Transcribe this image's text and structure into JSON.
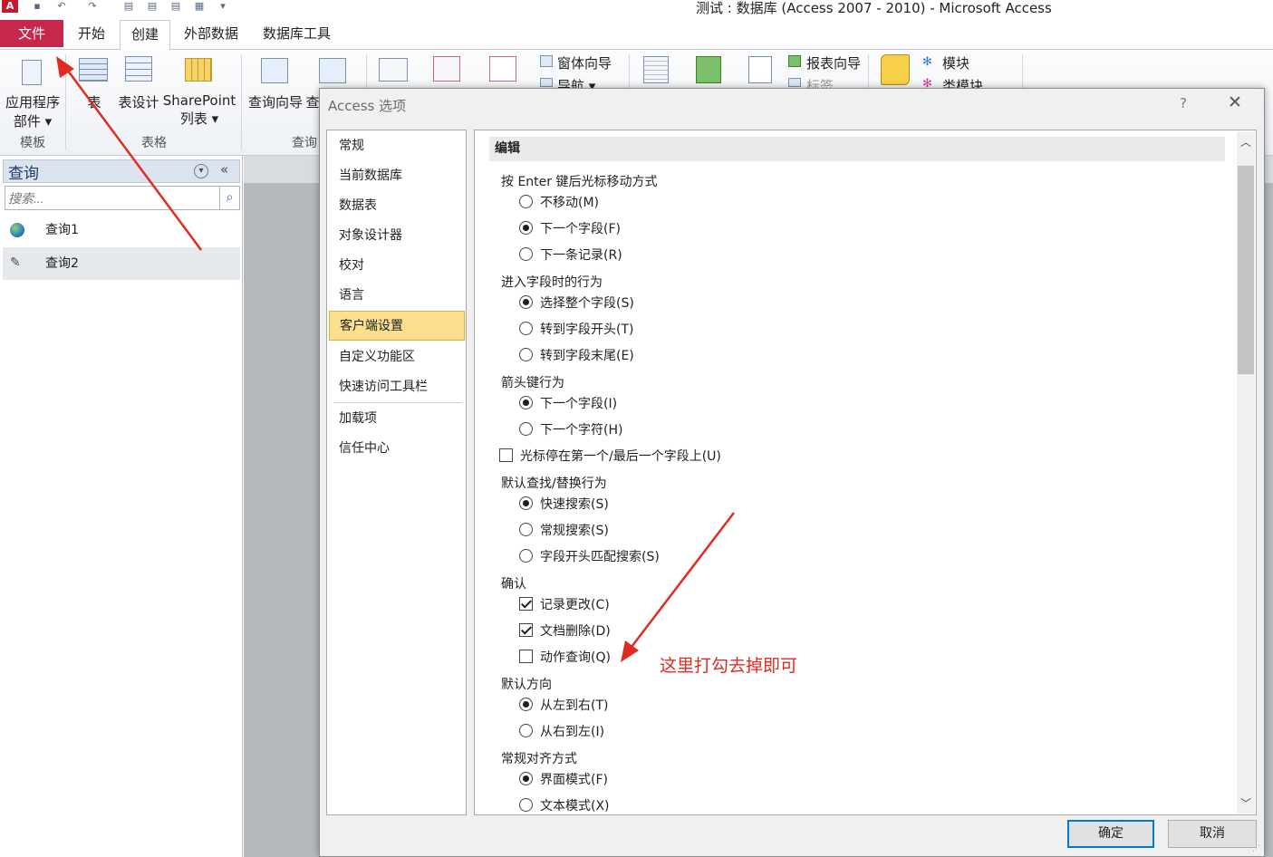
{
  "window": {
    "title": "测试 : 数据库 (Access 2007 - 2010)  -  Microsoft Access",
    "logo": "A"
  },
  "ribbon": {
    "tabs": [
      "文件",
      "开始",
      "创建",
      "外部数据",
      "数据库工具"
    ],
    "active_tab": "创建",
    "buttons": {
      "app_parts_line1": "应用程序",
      "app_parts_line2": "部件 ▾",
      "table": "表",
      "table_design": "表设计",
      "sharepoint_line1": "SharePoint",
      "sharepoint_line2": "列表 ▾",
      "query_wizard": "查询向导",
      "query_design_partial": "查",
      "form_wizard": "窗体向导",
      "navigation": "导航 ▾",
      "report_wizard": "报表向导",
      "labels": "标签",
      "module": "模块",
      "class_module": "类模块"
    },
    "groups": {
      "templates": "模板",
      "tables": "表格",
      "queries": "查询"
    }
  },
  "nav_pane": {
    "title": "查询",
    "search_placeholder": "搜索...",
    "items": [
      {
        "label": "查询1",
        "icon": "globe-query-icon"
      },
      {
        "label": "查询2",
        "icon": "update-query-icon",
        "selected": true
      }
    ]
  },
  "dialog": {
    "title": "Access 选项",
    "help": "?",
    "close": "✕",
    "nav": [
      "常规",
      "当前数据库",
      "数据表",
      "对象设计器",
      "校对",
      "语言",
      "客户端设置",
      "自定义功能区",
      "快速访问工具栏",
      "加载项",
      "信任中心"
    ],
    "active_nav": "客户端设置",
    "section_title": "编辑",
    "groups": [
      {
        "label": "按 Enter 键后光标移动方式",
        "type": "radio",
        "options": [
          {
            "label": "不移动(M)",
            "checked": false
          },
          {
            "label": "下一个字段(F)",
            "checked": true
          },
          {
            "label": "下一条记录(R)",
            "checked": false
          }
        ]
      },
      {
        "label": "进入字段时的行为",
        "type": "radio",
        "options": [
          {
            "label": "选择整个字段(S)",
            "checked": true
          },
          {
            "label": "转到字段开头(T)",
            "checked": false
          },
          {
            "label": "转到字段末尾(E)",
            "checked": false
          }
        ]
      },
      {
        "label": "箭头键行为",
        "type": "radio",
        "options": [
          {
            "label": "下一个字段(I)",
            "checked": true
          },
          {
            "label": "下一个字符(H)",
            "checked": false
          }
        ]
      },
      {
        "label": "",
        "type": "checkbox",
        "options": [
          {
            "label": "光标停在第一个/最后一个字段上(U)",
            "checked": false
          }
        ]
      },
      {
        "label": "默认查找/替换行为",
        "type": "radio",
        "options": [
          {
            "label": "快速搜索(S)",
            "checked": true
          },
          {
            "label": "常规搜索(S)",
            "checked": false
          },
          {
            "label": "字段开头匹配搜索(S)",
            "checked": false
          }
        ]
      },
      {
        "label": "确认",
        "type": "checkbox",
        "options": [
          {
            "label": "记录更改(C)",
            "checked": true
          },
          {
            "label": "文档删除(D)",
            "checked": true
          },
          {
            "label": "动作查询(Q)",
            "checked": false
          }
        ]
      },
      {
        "label": "默认方向",
        "type": "radio",
        "options": [
          {
            "label": "从左到右(T)",
            "checked": true
          },
          {
            "label": "从右到左(I)",
            "checked": false
          }
        ]
      },
      {
        "label": "常规对齐方式",
        "type": "radio",
        "options": [
          {
            "label": "界面模式(F)",
            "checked": true
          },
          {
            "label": "文本模式(X)",
            "checked": false
          }
        ]
      }
    ],
    "ok": "确定",
    "cancel": "取消"
  },
  "annotation": {
    "text": "这里打勾去掉即可",
    "color": "#e02b20"
  }
}
